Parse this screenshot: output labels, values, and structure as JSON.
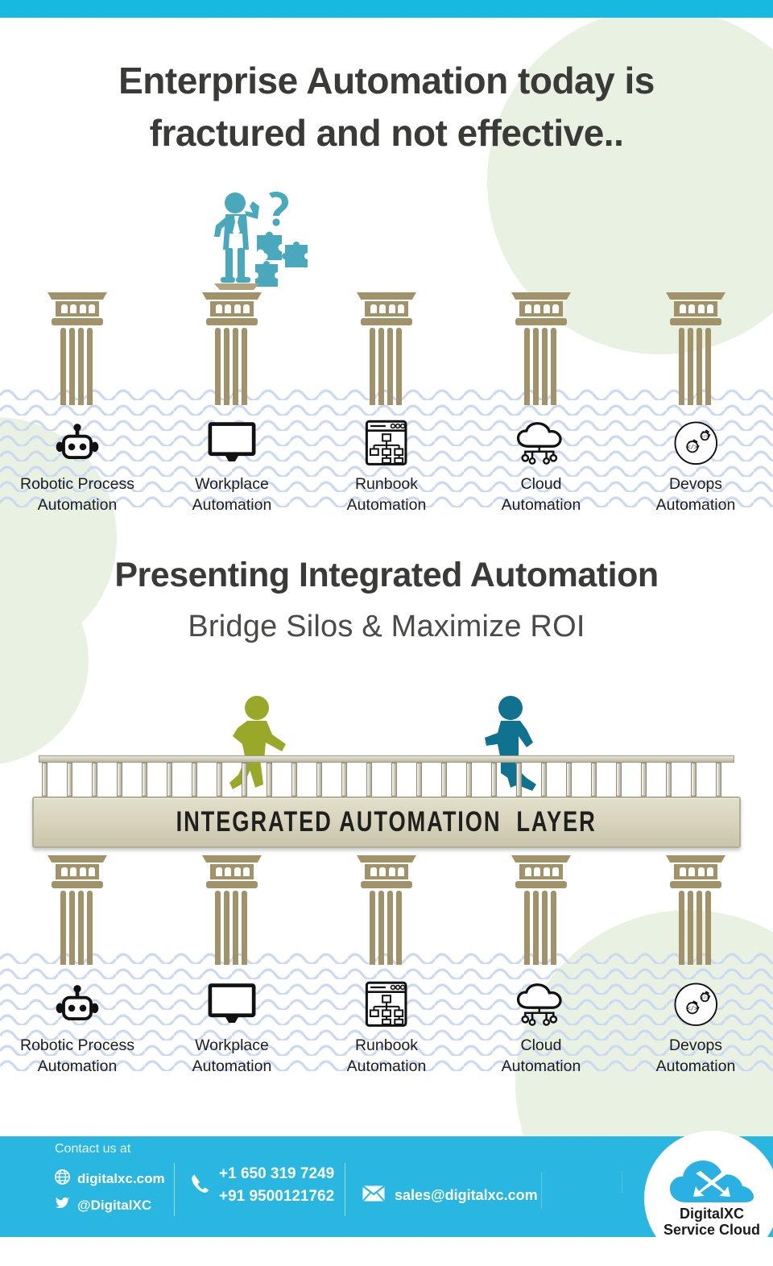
{
  "page": {
    "accent_cyan": "#18b9e0",
    "footer_cyan": "#29b6e0",
    "pillar_color": "#a1926a",
    "green_circle": "#e8f1e2",
    "wave_color": "#ccd9f2",
    "heading_color": "#3a3a38"
  },
  "top_section": {
    "headline_line1": "Enterprise Automation today is",
    "headline_line2": "fractured and not effective..",
    "confused_icon": "confused-businessman-puzzle-icon",
    "pillars": [
      {
        "icon": "robot-icon",
        "label": "Robotic Process\nAutomation"
      },
      {
        "icon": "monitor-icon",
        "label": "Workplace\nAutomation"
      },
      {
        "icon": "runbook-window-icon",
        "label": "Runbook\nAutomation"
      },
      {
        "icon": "cloud-nodes-icon",
        "label": "Cloud\nAutomation"
      },
      {
        "icon": "devops-gears-icon",
        "label": "Devops\nAutomation"
      }
    ]
  },
  "bottom_section": {
    "heading": "Presenting Integrated Automation",
    "subheading": "Bridge Silos & Maximize ROI",
    "layer_bar_label": "INTEGRATED AUTOMATION  LAYER",
    "walkers": [
      {
        "name": "walking-person-green",
        "color": "#9aa82a"
      },
      {
        "name": "walking-person-teal",
        "color": "#11728f"
      }
    ],
    "pillars": [
      {
        "icon": "robot-icon",
        "label": "Robotic Process\nAutomation"
      },
      {
        "icon": "monitor-icon",
        "label": "Workplace\nAutomation"
      },
      {
        "icon": "runbook-window-icon",
        "label": "Runbook\nAutomation"
      },
      {
        "icon": "cloud-nodes-icon",
        "label": "Cloud\nAutomation"
      },
      {
        "icon": "devops-gears-icon",
        "label": "Devops\nAutomation"
      }
    ]
  },
  "footer": {
    "contact_label": "Contact us at",
    "website": "digitalxc.com",
    "twitter": "@DigitalXC",
    "phone_us": "+1 650 319 7249",
    "phone_in": "+91 9500121762",
    "email": "sales@digitalxc.com",
    "icons": {
      "globe": "globe-icon",
      "twitter": "twitter-bird-icon",
      "phone": "phone-icon",
      "mail": "envelope-icon"
    },
    "logo": {
      "name": "digitalxc-cloud-logo",
      "line1": "DigitalXC",
      "line2": "Service Cloud"
    }
  }
}
